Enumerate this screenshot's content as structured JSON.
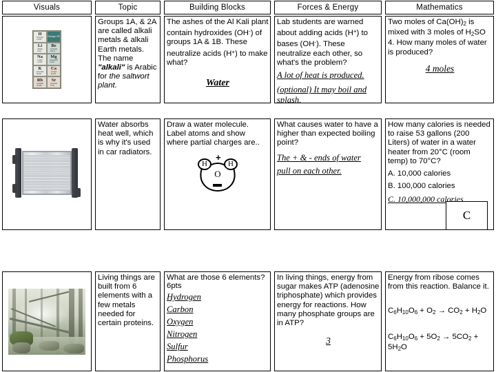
{
  "headers": [
    {
      "label": "Visuals"
    },
    {
      "label": "Topic"
    },
    {
      "label": "Building Blocks"
    },
    {
      "label": "Forces & Energy"
    },
    {
      "label": "Mathematics"
    }
  ],
  "row1": {
    "visual": {
      "alt": "periodic-table-groups-1a-2a",
      "group_header": "Groups 2A",
      "column1": [
        "H",
        "Li",
        "Na",
        "K",
        "Rb"
      ],
      "column2": [
        "Be",
        "Mg",
        "Ca",
        "Sr"
      ]
    },
    "topic": {
      "line1": "Groups 1A, & 2A are called alkali metals & alkali Earth metals.  The name ",
      "quoted": "\"alkali\"",
      "line2": " is Arabic for ",
      "italic": "the saltwort plant."
    },
    "building_blocks": {
      "question_a": "The ashes of the Al Kali plant contain hydroxides (OH",
      "question_b": "-",
      "question_c": ") of groups 1A & 1B. These neutralize acids  (H",
      "question_d": "+",
      "question_e": ") to make what?",
      "answer": "Water"
    },
    "forces_energy": {
      "question_a": "Lab students are warned about adding acids (H",
      "question_b": "+",
      "question_c": ") to bases (OH",
      "question_d": "-",
      "question_e": ").  These neutralize each other, so what's the problem?",
      "answer_line1": "A lot of heat is produced.",
      "answer_line2": "(optional) It may boil and splash."
    },
    "mathematics": {
      "q_a": "Two moles of Ca(OH)",
      "q_sub": "2",
      "q_b": " is mixed with 3 moles of H",
      "q_sub2": "2",
      "q_c": "SO 4. How many moles of water is produced?",
      "answer": "4 moles"
    }
  },
  "row2": {
    "visual": {
      "alt": "car-radiator-photo"
    },
    "topic": {
      "text": "Water absorbs heat well, which is why it's used in car radiators."
    },
    "building_blocks": {
      "question": "Draw a water molecule.  Label atoms and show where partial charges are..",
      "diagram": {
        "atom_left": "H",
        "atom_right": "H",
        "atom_center": "O",
        "plus": "+",
        "minus": "—"
      }
    },
    "forces_energy": {
      "question": "What causes water to have a higher than expected boiling point?",
      "answer_line1": "The + & - ends of water",
      "answer_line2": "pull on each other."
    },
    "mathematics": {
      "question": "How many calories is needed to raise 53 gallons (200 Liters) of water in a water heater from 20°C (room temp) to 70°C?",
      "choices": [
        "A.  10,000 calories",
        "B.  100,000 calories",
        "C.  10,000,000 calories"
      ],
      "revealed_answer": "C"
    }
  },
  "row3": {
    "visual": {
      "alt": "misty-forest-stream-photo"
    },
    "topic": {
      "text": "Living things are built from 6 elements with a few metals needed for certain proteins."
    },
    "building_blocks": {
      "question": "What are those 6 elements?",
      "points": "6pts",
      "answers": [
        "Hydrogen",
        "Carbon",
        "Oxygen",
        "Nitrogen",
        "Sulfur",
        "Phosphorus"
      ]
    },
    "forces_energy": {
      "question": "In living things, energy from sugar makes ATP (adenosine triphosphate) which provides energy for reactions.  How many phosphate groups are in ATP?",
      "answer": "3"
    },
    "mathematics": {
      "question": "Energy from ribose comes from this reaction.  Balance it.",
      "equation_unbalanced": {
        "parts": [
          "C",
          "6",
          "H",
          "10",
          "O",
          "6",
          " + O",
          "2",
          " → CO",
          "2",
          " +  H",
          "2",
          "O"
        ]
      },
      "equation_balanced": {
        "parts": [
          "C",
          "6",
          "H",
          "10",
          "O",
          "6",
          " + 5O",
          "2",
          " → 5CO",
          "2",
          " + 5H",
          "2",
          "O"
        ]
      }
    }
  },
  "colors": {
    "border": "#000000",
    "background": "#ffffff",
    "text": "#000000"
  }
}
